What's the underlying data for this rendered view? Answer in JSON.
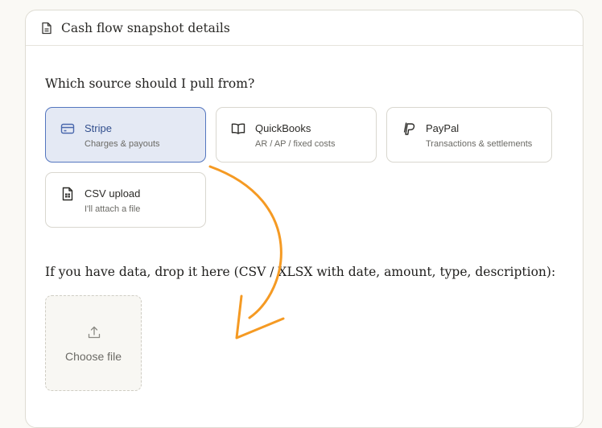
{
  "header": {
    "title": "Cash flow snapshot details",
    "icon": "document-icon"
  },
  "question": "Which source should I pull from?",
  "sources": [
    {
      "title": "Stripe",
      "subtitle": "Charges & payouts",
      "icon": "credit-card-icon",
      "selected": true
    },
    {
      "title": "QuickBooks",
      "subtitle": "AR / AP / fixed costs",
      "icon": "book-open-icon",
      "selected": false
    },
    {
      "title": "PayPal",
      "subtitle": "Transactions & settlements",
      "icon": "paypal-icon",
      "selected": false
    },
    {
      "title": "CSV upload",
      "subtitle": "I'll attach a file",
      "icon": "spreadsheet-file-icon",
      "selected": false
    }
  ],
  "drop_label": "If you have data, drop it here (CSV / XLSX with date, amount, type, description):",
  "dropzone": {
    "label": "Choose file",
    "icon": "upload-icon"
  },
  "colors": {
    "accent": "#5476bf",
    "selected_bg": "#e4e9f4",
    "annotation_arrow": "#f59a23"
  }
}
